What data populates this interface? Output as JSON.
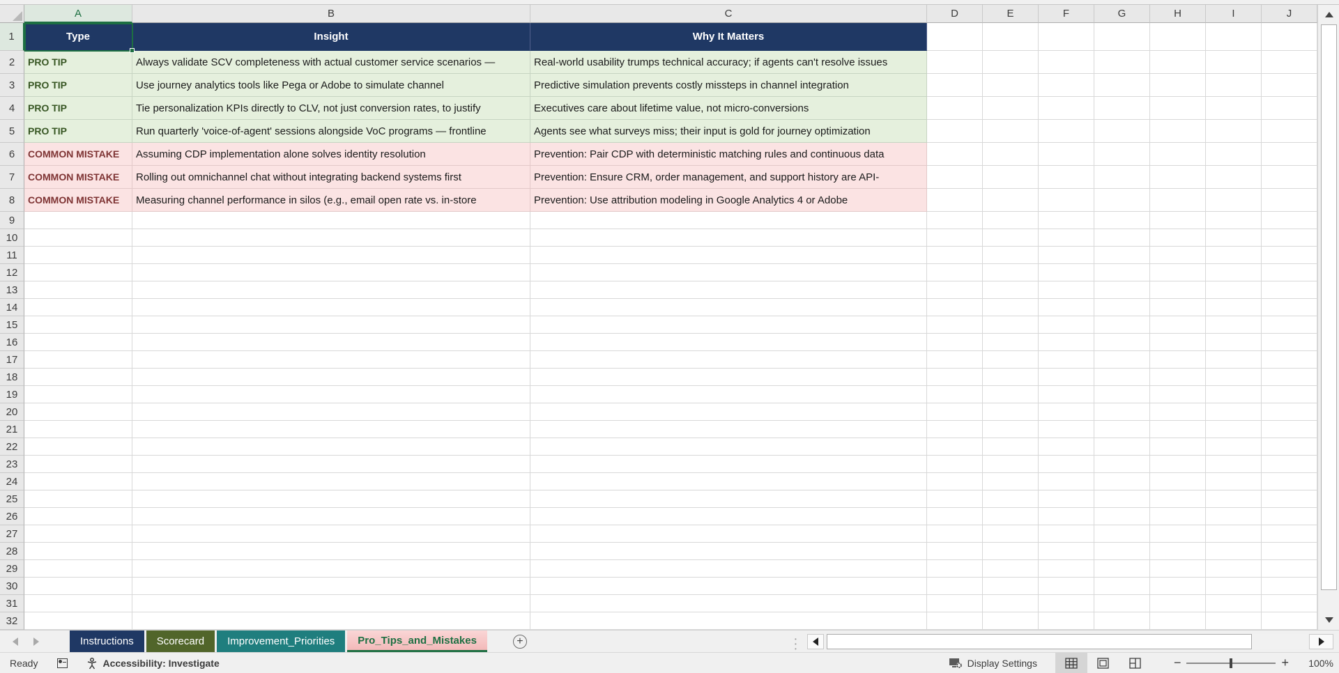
{
  "app": {
    "title": "Excel worksheet"
  },
  "grid": {
    "column_letters": [
      "A",
      "B",
      "C",
      "D",
      "E",
      "F",
      "G",
      "H",
      "I",
      "J"
    ],
    "first_row": 1,
    "last_visible_row": 32,
    "active_cell": "A1",
    "selected_column": "A",
    "selected_row": "1"
  },
  "table": {
    "headers": {
      "type": "Type",
      "insight": "Insight",
      "why": "Why It Matters"
    },
    "rows": [
      {
        "kind": "tip",
        "type": "PRO TIP",
        "insight": "Always validate SCV completeness with actual customer service scenarios —",
        "why": "Real-world usability trumps technical accuracy; if agents can't resolve issues"
      },
      {
        "kind": "tip",
        "type": "PRO TIP",
        "insight": "Use journey analytics tools like Pega or Adobe to simulate channel",
        "why": "Predictive simulation prevents costly missteps in channel integration"
      },
      {
        "kind": "tip",
        "type": "PRO TIP",
        "insight": "Tie personalization KPIs directly to CLV, not just conversion rates, to justify",
        "why": "Executives care about lifetime value, not micro-conversions"
      },
      {
        "kind": "tip",
        "type": "PRO TIP",
        "insight": "Run quarterly 'voice-of-agent' sessions alongside VoC programs — frontline",
        "why": "Agents see what surveys miss; their input is gold for journey optimization"
      },
      {
        "kind": "mistake",
        "type": "COMMON MISTAKE",
        "insight": "Assuming CDP implementation alone solves identity resolution",
        "why": "Prevention: Pair CDP with deterministic matching rules and continuous data"
      },
      {
        "kind": "mistake",
        "type": "COMMON MISTAKE",
        "insight": "Rolling out omnichannel chat without integrating backend systems first",
        "why": "Prevention: Ensure CRM, order management, and support history are API-"
      },
      {
        "kind": "mistake",
        "type": "COMMON MISTAKE",
        "insight": "Measuring channel performance in silos (e.g., email open rate vs. in-store",
        "why": "Prevention: Use attribution modeling in Google Analytics 4 or Adobe"
      }
    ]
  },
  "sheet_tabs": [
    {
      "label": "Instructions",
      "color": "#1F3864",
      "text_color": "#FFFFFF",
      "active": false
    },
    {
      "label": "Scorecard",
      "color": "#51652A",
      "text_color": "#FFFFFF",
      "active": false
    },
    {
      "label": "Improvement_Priorities",
      "color": "#1F7E7E",
      "text_color": "#FFFFFF",
      "active": false
    },
    {
      "label": "Pro_Tips_and_Mistakes",
      "color": "#F3B9B9",
      "text_color": "#1D6F42",
      "active": true
    }
  ],
  "tab_bar": {
    "new_sheet_glyph": "+"
  },
  "status_bar": {
    "ready": "Ready",
    "accessibility": "Accessibility: Investigate",
    "display_settings": "Display Settings",
    "zoom_level": "100%"
  },
  "colors": {
    "header_fill": "#1F3864",
    "header_text": "#FFFFFF",
    "tip_fill": "#E5F0DD",
    "tip_text": "#375623",
    "mistake_fill": "#FBE3E3",
    "mistake_text": "#7E3333",
    "selection_green": "#1D6F42",
    "active_tab_underline": "#1D6F42"
  }
}
